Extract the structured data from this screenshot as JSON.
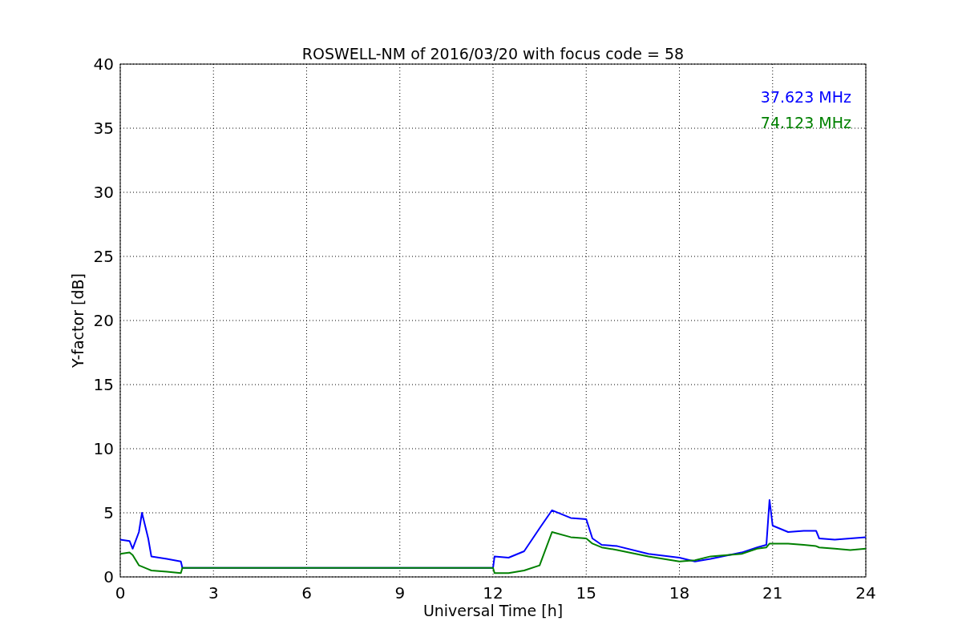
{
  "figure": {
    "chart_data": {
      "type": "line",
      "title": "ROSWELL-NM of 2016/03/20 with focus code = 58",
      "xlabel": "Universal Time [h]",
      "ylabel": "Y-factor [dB]",
      "x": [
        0,
        0.3,
        0.4,
        0.6,
        0.7,
        0.9,
        1.0,
        1.5,
        1.95,
        2.0,
        12.0,
        12.05,
        12.5,
        13.0,
        13.5,
        13.9,
        14.5,
        15.0,
        15.2,
        15.5,
        16,
        17,
        18,
        18.5,
        19,
        20,
        20.5,
        20.8,
        20.9,
        21.0,
        21.5,
        22.0,
        22.4,
        22.5,
        23,
        23.5,
        24
      ],
      "series": [
        {
          "name": "37.623 MHz",
          "color": "#0000ff",
          "values": [
            2.9,
            2.8,
            2.2,
            3.5,
            5.0,
            3.0,
            1.6,
            1.4,
            1.2,
            0.7,
            0.7,
            1.6,
            1.5,
            2.0,
            3.8,
            5.2,
            4.6,
            4.5,
            3.0,
            2.5,
            2.4,
            1.8,
            1.5,
            1.2,
            1.4,
            1.9,
            2.3,
            2.5,
            6.0,
            4.0,
            3.5,
            3.6,
            3.6,
            3.0,
            2.9,
            3.0,
            3.1
          ]
        },
        {
          "name": "74.123 MHz",
          "color": "#008000",
          "values": [
            1.8,
            1.9,
            1.7,
            0.9,
            0.8,
            0.6,
            0.5,
            0.4,
            0.3,
            0.7,
            0.7,
            0.3,
            0.3,
            0.5,
            0.9,
            3.5,
            3.1,
            3.0,
            2.6,
            2.3,
            2.1,
            1.6,
            1.2,
            1.3,
            1.6,
            1.8,
            2.2,
            2.3,
            2.6,
            2.6,
            2.6,
            2.5,
            2.4,
            2.3,
            2.2,
            2.1,
            2.2
          ]
        }
      ],
      "xlim": [
        0,
        24
      ],
      "ylim": [
        0,
        40
      ],
      "xticks": [
        0,
        3,
        6,
        9,
        12,
        15,
        18,
        21,
        24
      ],
      "yticks": [
        0,
        5,
        10,
        15,
        20,
        25,
        30,
        35,
        40
      ],
      "grid": true
    }
  }
}
